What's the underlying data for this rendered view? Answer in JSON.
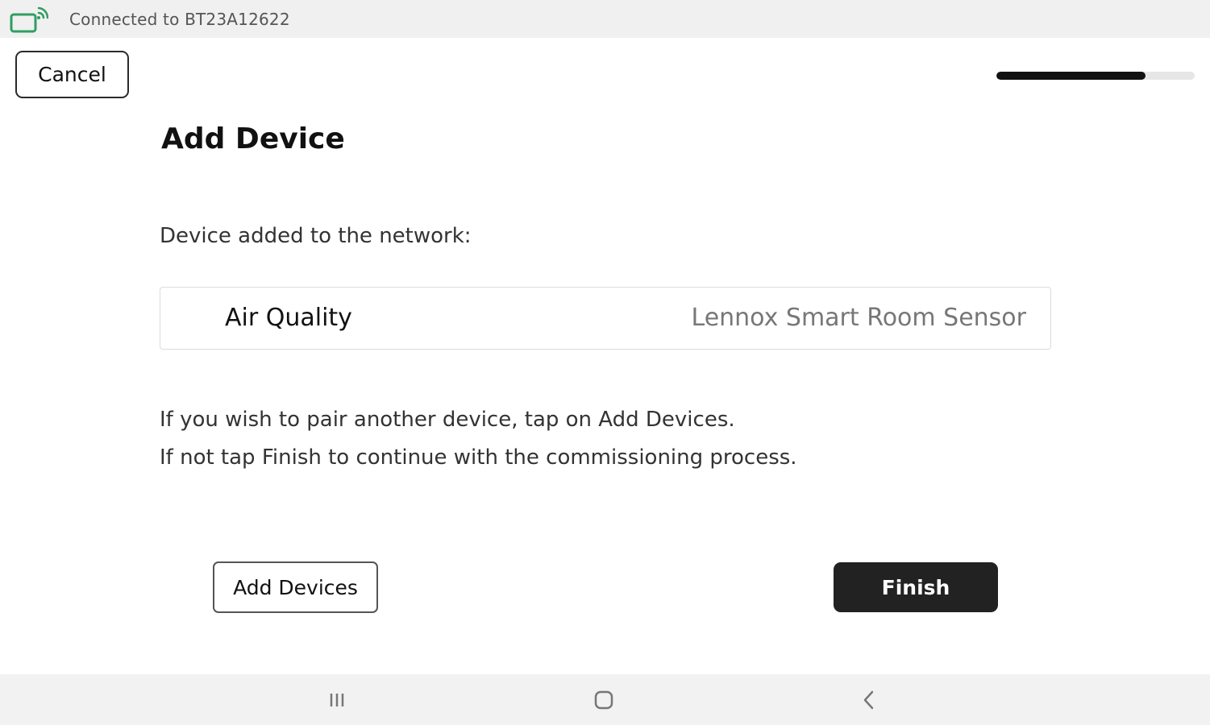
{
  "status_bar": {
    "connection_text": "Connected to BT23A12622",
    "icon": "bluetooth-connected-icon",
    "accent_color": "#2e9e62"
  },
  "header": {
    "cancel_label": "Cancel",
    "progress_fraction": 0.75
  },
  "main": {
    "title": "Add Device",
    "subtitle": "Device added to the network:",
    "device": {
      "name": "Air Quality",
      "model": "Lennox Smart Room Sensor"
    },
    "info_lines": [
      "If you wish to pair another device, tap on Add Devices.",
      "If not tap Finish to continue with the commissioning process."
    ]
  },
  "actions": {
    "add_devices_label": "Add Devices",
    "finish_label": "Finish"
  },
  "nav_bar": {
    "recent_icon": "recent-apps-icon",
    "home_icon": "home-icon",
    "back_icon": "back-icon"
  }
}
